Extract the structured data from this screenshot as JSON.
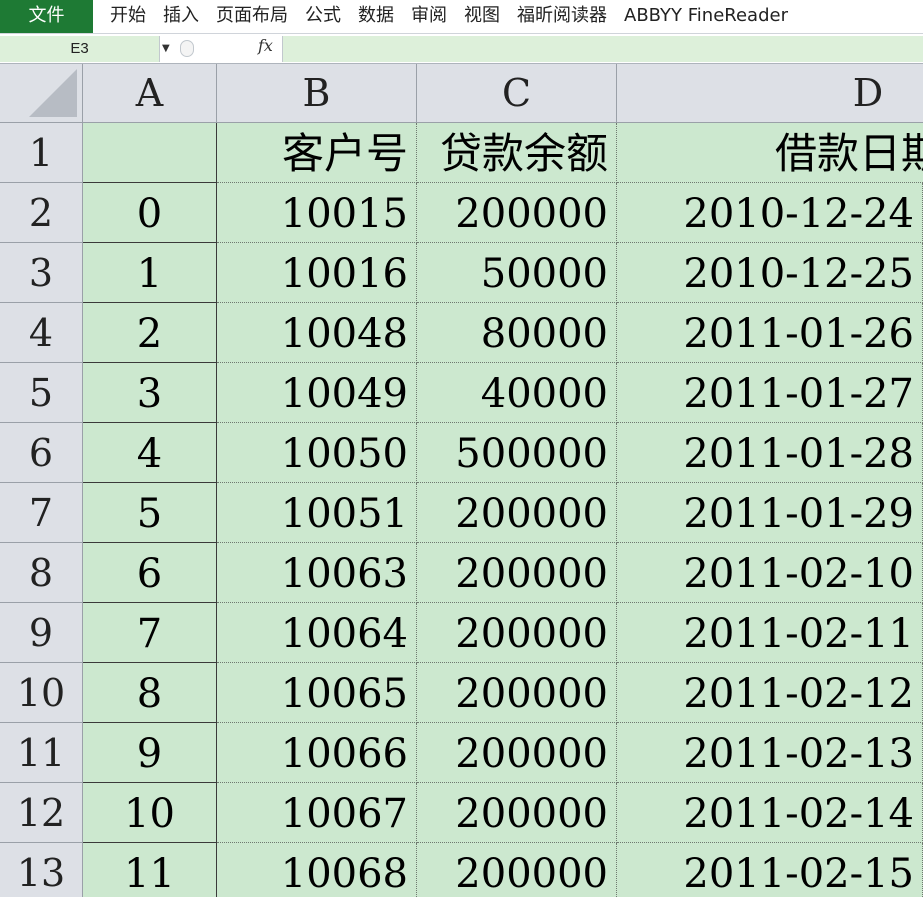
{
  "ribbon": {
    "file_tab": "文件",
    "tabs": [
      "开始",
      "插入",
      "页面布局",
      "公式",
      "数据",
      "审阅",
      "视图",
      "福昕阅读器",
      "ABBYY FineReader"
    ]
  },
  "formula_bar": {
    "name_box": "E3",
    "fx_label": "fx",
    "formula": ""
  },
  "columns": [
    "A",
    "B",
    "C",
    "D"
  ],
  "header_row": {
    "row_number": "1",
    "A": "",
    "B": "客户号",
    "C": "贷款余额",
    "D": "借款日期"
  },
  "rows": [
    {
      "n": "2",
      "A": "0",
      "B": "10015",
      "C": "200000",
      "D": "2010-12-24"
    },
    {
      "n": "3",
      "A": "1",
      "B": "10016",
      "C": "50000",
      "D": "2010-12-25"
    },
    {
      "n": "4",
      "A": "2",
      "B": "10048",
      "C": "80000",
      "D": "2011-01-26"
    },
    {
      "n": "5",
      "A": "3",
      "B": "10049",
      "C": "40000",
      "D": "2011-01-27"
    },
    {
      "n": "6",
      "A": "4",
      "B": "10050",
      "C": "500000",
      "D": "2011-01-28"
    },
    {
      "n": "7",
      "A": "5",
      "B": "10051",
      "C": "200000",
      "D": "2011-01-29"
    },
    {
      "n": "8",
      "A": "6",
      "B": "10063",
      "C": "200000",
      "D": "2011-02-10"
    },
    {
      "n": "9",
      "A": "7",
      "B": "10064",
      "C": "200000",
      "D": "2011-02-11"
    },
    {
      "n": "10",
      "A": "8",
      "B": "10065",
      "C": "200000",
      "D": "2011-02-12"
    },
    {
      "n": "11",
      "A": "9",
      "B": "10066",
      "C": "200000",
      "D": "2011-02-13"
    },
    {
      "n": "12",
      "A": "10",
      "B": "10067",
      "C": "200000",
      "D": "2011-02-14"
    },
    {
      "n": "13",
      "A": "11",
      "B": "10068",
      "C": "200000",
      "D": "2011-02-15"
    }
  ],
  "colors": {
    "file_tab": "#1e7a34",
    "cell_fill": "#cce8cf",
    "header_fill": "#dde0e6"
  },
  "icons": {
    "name_box_dropdown": "chevron-down-icon",
    "function": "fx-icon",
    "select_all": "select-all-triangle-icon"
  }
}
